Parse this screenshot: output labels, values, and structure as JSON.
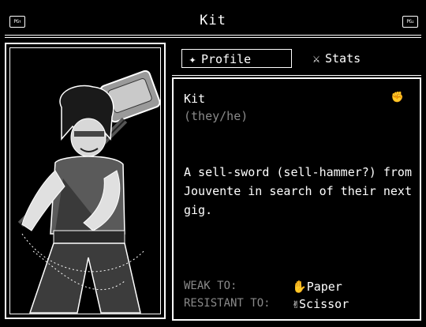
{
  "header": {
    "title": "Kit",
    "left_key": "PG↑",
    "right_key": "PG↓"
  },
  "tabs": [
    {
      "label": "Profile",
      "icon": "sparkle-icon",
      "glyph": "✦",
      "selected": true
    },
    {
      "label": "Stats",
      "icon": "sword-icon",
      "glyph": "⚔",
      "selected": false
    }
  ],
  "profile": {
    "name": "Kit",
    "pronouns": "(they/he)",
    "type_icon": "rock-fist-icon",
    "type_glyph": "✊",
    "description": "A sell-sword (sell-hammer?) from Jouvente in search of their next gig.",
    "weak_label": "WEAK TO:",
    "weak_value": "Paper",
    "weak_icon": "paper-hand-icon",
    "weak_glyph": "✋",
    "resist_label": "RESISTANT TO:",
    "resist_value": "Scissor",
    "resist_icon": "scissor-hand-icon",
    "resist_glyph": "✌"
  },
  "colors": {
    "background": "#000000",
    "foreground": "#ffffff",
    "muted": "#8a8a8a"
  }
}
